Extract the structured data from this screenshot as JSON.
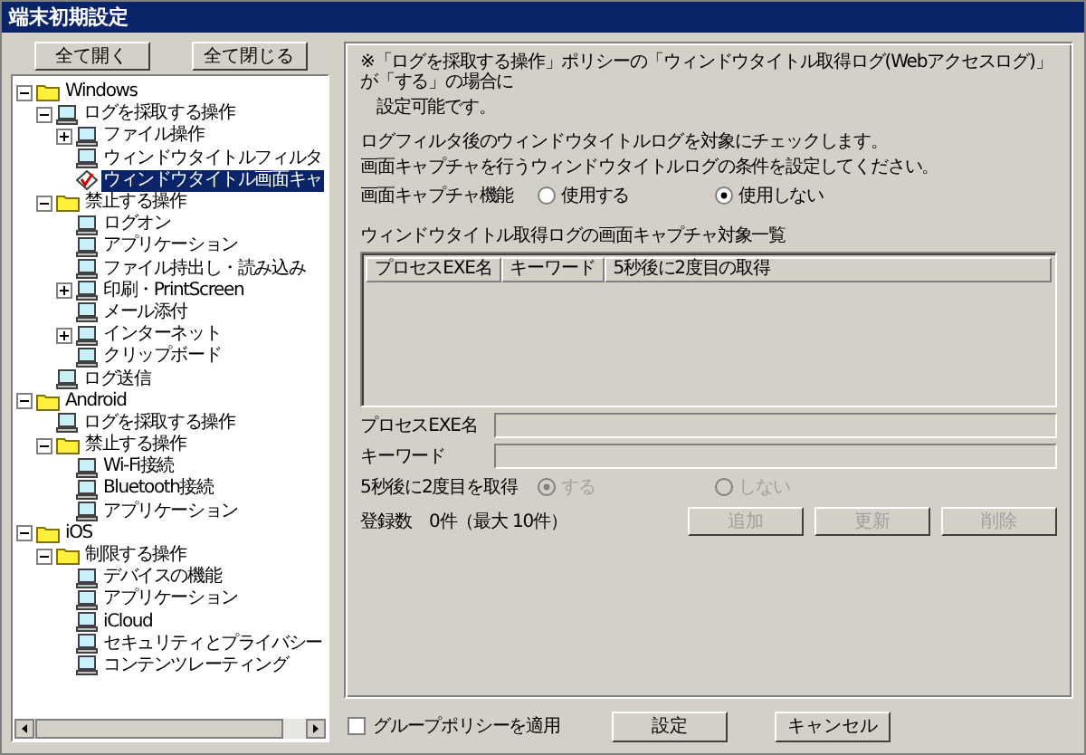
{
  "window": {
    "title": "端末初期設定"
  },
  "tree_buttons": [
    "全て開く",
    "全て閉じる"
  ],
  "tree": [
    {
      "label": "Windows",
      "kind": "folder",
      "expanded": true,
      "selected": false,
      "children": [
        {
          "label": "ログを採取する操作",
          "kind": "monitor",
          "expanded": true,
          "selected": false,
          "children": [
            {
              "label": "ファイル操作",
              "kind": "monitor",
              "expanded": false,
              "selected": false
            },
            {
              "label": "ウィンドウタイトルフィルタ",
              "kind": "monitor",
              "selected": false
            },
            {
              "label": "ウィンドウタイトル画面キャ",
              "kind": "check",
              "selected": true
            }
          ]
        },
        {
          "label": "禁止する操作",
          "kind": "folder",
          "expanded": true,
          "selected": false,
          "children": [
            {
              "label": "ログオン",
              "kind": "monitor",
              "selected": false
            },
            {
              "label": "アプリケーション",
              "kind": "monitor",
              "selected": false
            },
            {
              "label": "ファイル持出し・読み込み",
              "kind": "monitor",
              "selected": false
            },
            {
              "label": "印刷・PrintScreen",
              "kind": "monitor",
              "expanded": false,
              "selected": false
            },
            {
              "label": "メール添付",
              "kind": "monitor",
              "selected": false
            },
            {
              "label": "インターネット",
              "kind": "monitor",
              "expanded": false,
              "selected": false
            },
            {
              "label": "クリップボード",
              "kind": "monitor",
              "selected": false
            }
          ]
        },
        {
          "label": "ログ送信",
          "kind": "monitor",
          "selected": false
        }
      ]
    },
    {
      "label": "Android",
      "kind": "folder",
      "expanded": true,
      "selected": false,
      "children": [
        {
          "label": "ログを採取する操作",
          "kind": "monitor",
          "selected": false
        },
        {
          "label": "禁止する操作",
          "kind": "folder",
          "expanded": true,
          "selected": false,
          "children": [
            {
              "label": "Wi-Fi接続",
              "kind": "monitor",
              "selected": false
            },
            {
              "label": "Bluetooth接続",
              "kind": "monitor",
              "selected": false
            },
            {
              "label": "アプリケーション",
              "kind": "monitor",
              "selected": false
            }
          ]
        }
      ]
    },
    {
      "label": "iOS",
      "kind": "folder",
      "expanded": true,
      "selected": false,
      "children": [
        {
          "label": "制限する操作",
          "kind": "folder",
          "expanded": true,
          "selected": false,
          "children": [
            {
              "label": "デバイスの機能",
              "kind": "monitor",
              "selected": false
            },
            {
              "label": "アプリケーション",
              "kind": "monitor",
              "selected": false
            },
            {
              "label": "iCloud",
              "kind": "monitor",
              "selected": false
            },
            {
              "label": "セキュリティとプライバシー",
              "kind": "monitor",
              "selected": false
            },
            {
              "label": "コンテンツレーティング",
              "kind": "monitor",
              "selected": false
            }
          ]
        }
      ]
    }
  ],
  "panel": {
    "note": [
      "※「ログを採取する操作」ポリシーの「ウィンドウタイトル取得ログ(Webアクセスログ)」が「する」の場合に",
      "設定可能です。"
    ],
    "description": [
      "ログフィルタ後のウィンドウタイトルログを対象にチェックします。",
      "画面キャプチャを行うウィンドウタイトルログの条件を設定してください。"
    ],
    "capture": {
      "label": "画面キャプチャ機能",
      "disabled": false,
      "options": [
        {
          "label": "使用する",
          "selected": false
        },
        {
          "label": "使用しない",
          "selected": true
        }
      ]
    },
    "list_label": "ウィンドウタイトル取得ログの画面キャプチャ対象一覧",
    "table": {
      "columns": [
        "プロセスEXE名",
        "キーワード",
        "5秒後に2度目の取得"
      ]
    },
    "fields": [
      {
        "label": "プロセスEXE名",
        "disabled": true
      },
      {
        "label": "キーワード",
        "disabled": true
      }
    ],
    "second_capture": {
      "label": "5秒後に2度目を取得",
      "disabled": true,
      "options": [
        {
          "label": "する",
          "selected": true
        },
        {
          "label": "しない",
          "selected": false
        }
      ]
    },
    "count_label": "登録数",
    "count_value": "0件（最大 10件）",
    "actions": [
      {
        "label": "追加",
        "disabled": true
      },
      {
        "label": "更新",
        "disabled": true
      },
      {
        "label": "削除",
        "disabled": true
      }
    ]
  },
  "footer": {
    "group_policy": {
      "label": "グループポリシーを適用",
      "checked": false
    },
    "buttons": [
      "設定",
      "キャンセル"
    ]
  }
}
